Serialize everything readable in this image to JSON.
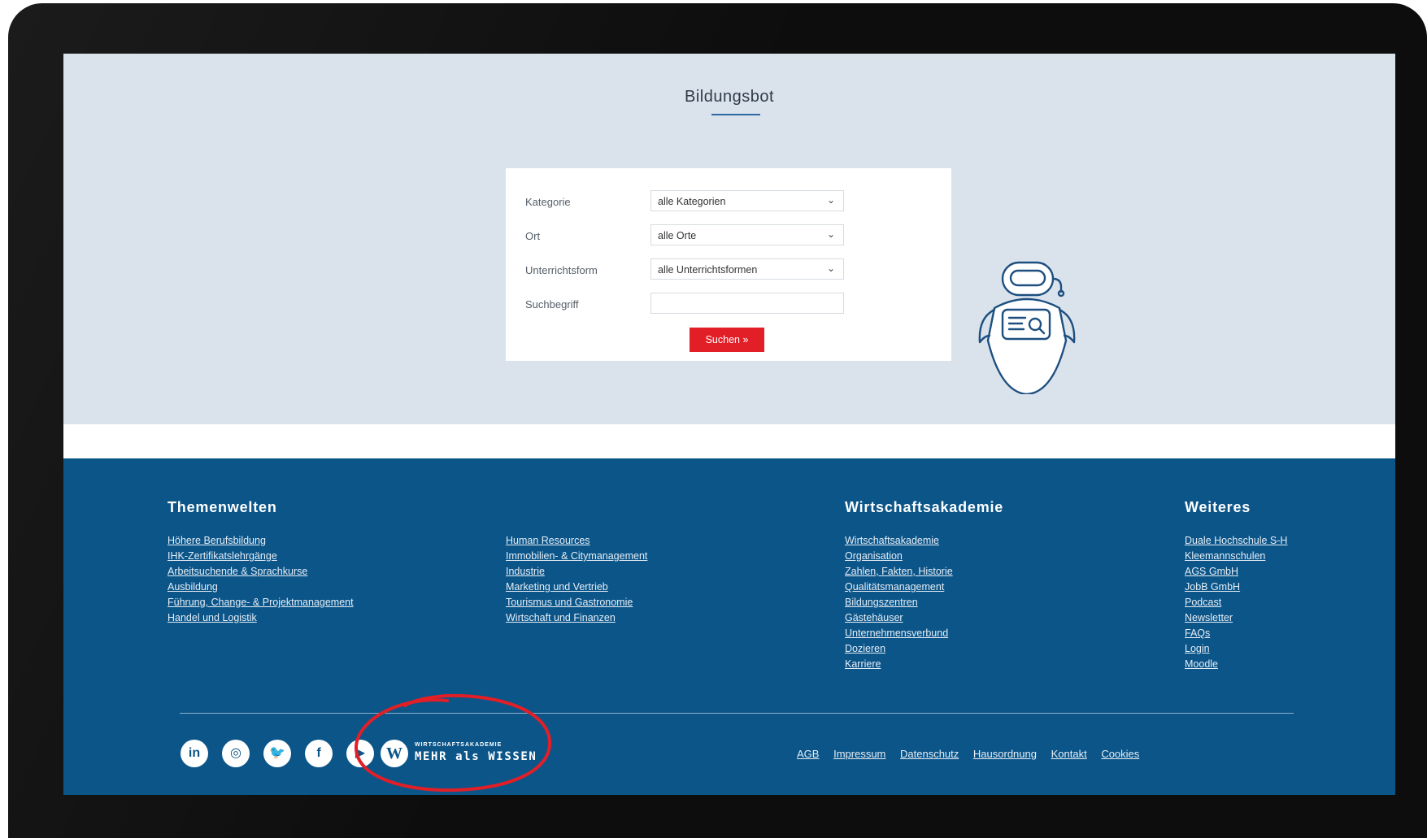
{
  "page": {
    "title": "Bildungsbot"
  },
  "form": {
    "category": {
      "label": "Kategorie",
      "value": "alle Kategorien"
    },
    "location": {
      "label": "Ort",
      "value": "alle Orte"
    },
    "mode": {
      "label": "Unterrichtsform",
      "value": "alle Unterrichtsformen"
    },
    "search": {
      "label": "Suchbegriff",
      "value": ""
    },
    "submit_label": "Suchen »"
  },
  "footer": {
    "columns": [
      {
        "heading": "Themenwelten",
        "links": [
          "Höhere Berufsbildung",
          "IHK-Zertifikatslehrgänge",
          "Arbeitsuchende & Sprachkurse",
          "Ausbildung",
          "Führung, Change- & Projektmanagement",
          "Handel und Logistik"
        ]
      },
      {
        "heading": "",
        "links": [
          "Human Resources",
          "Immobilien- & Citymanagement",
          "Industrie",
          "Marketing und Vertrieb",
          "Tourismus und Gastronomie",
          "Wirtschaft und Finanzen"
        ]
      },
      {
        "heading": "Wirtschaftsakademie",
        "links": [
          "Wirtschaftsakademie",
          "Organisation",
          "Zahlen, Fakten, Historie",
          "Qualitätsmanagement",
          "Bildungszentren",
          "Gästehäuser",
          "Unternehmensverbund",
          "Dozieren",
          "Karriere"
        ]
      },
      {
        "heading": "Weiteres",
        "links": [
          "Duale Hochschule S-H",
          "Kleemannschulen",
          "AGS GmbH",
          "JobB GmbH",
          "Podcast",
          "Newsletter",
          "FAQs",
          "Login",
          "Moodle"
        ]
      }
    ],
    "social": {
      "linkedin": "in",
      "instagram": "◎",
      "twitter": "🐦",
      "facebook": "f",
      "youtube": "▶"
    },
    "logo": {
      "mark": "W",
      "small_text": "WIRTSCHAFTSAKADEMIE",
      "tagline": "MEHR als WISSEN"
    },
    "legal_links": [
      "AGB",
      "Impressum",
      "Datenschutz",
      "Hausordnung",
      "Kontakt",
      "Cookies"
    ]
  },
  "colors": {
    "header_bg": "#dae3ec",
    "footer_bg": "#0b5589",
    "button_red": "#e21f26",
    "accent_blue": "#2c6aa3",
    "annotation_red": "#e21f26"
  },
  "icons": [
    "chevron-down-icon",
    "robot-icon",
    "linkedin-icon",
    "instagram-icon",
    "twitter-icon",
    "facebook-icon",
    "youtube-icon"
  ]
}
